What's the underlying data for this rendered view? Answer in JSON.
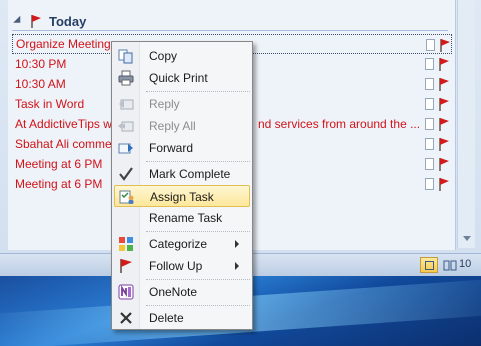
{
  "todo": {
    "group_title": "Today",
    "tasks": [
      {
        "text": "Organize Meeting"
      },
      {
        "text": "10:30 PM"
      },
      {
        "text": "10:30 AM"
      },
      {
        "text": "Task in Word"
      },
      {
        "text": "At AddictiveTips we",
        "tail": "nd services from around the ..."
      },
      {
        "text": "Sbahat Ali comment"
      },
      {
        "text": "Meeting at 6 PM"
      },
      {
        "text": "Meeting at 6 PM"
      }
    ]
  },
  "statusbar": {
    "zoom": "10"
  },
  "menu": {
    "copy": "Copy",
    "quick_print": "Quick Print",
    "reply": "Reply",
    "reply_all": "Reply All",
    "forward": "Forward",
    "mark_complete": "Mark Complete",
    "assign_task": "Assign Task",
    "rename_task": "Rename Task",
    "categorize": "Categorize",
    "follow_up": "Follow Up",
    "onenote": "OneNote",
    "delete": "Delete"
  },
  "colors": {
    "task_text": "#d01317",
    "highlight": "#fde79b",
    "flag": "#d21a1a"
  },
  "icons": [
    "flag-icon",
    "copy-icon",
    "printer-icon",
    "reply-icon",
    "reply-all-icon",
    "forward-icon",
    "checkmark-icon",
    "assign-task-icon",
    "categorize-icon",
    "follow-up-flag-icon",
    "onenote-icon",
    "delete-icon"
  ]
}
